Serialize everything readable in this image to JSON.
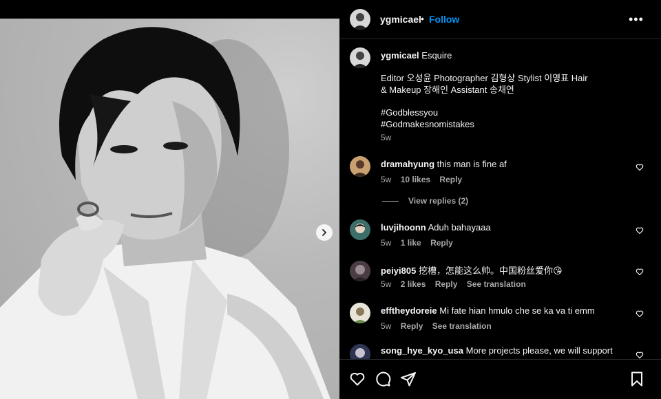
{
  "post": {
    "username": "ygmicael",
    "follow_label": "Follow",
    "more_label": "•••",
    "dot": "•"
  },
  "caption": {
    "username": "ygmicael",
    "title": "Esquire",
    "line1": "Editor 오성윤 Photographer 김형상 Stylist 이영표 Hair",
    "line2": "& Makeup 장해인 Assistant 송채연",
    "tag1": "#Godblessyou",
    "tag2": "#Godmakesnomistakes",
    "time": "5w"
  },
  "comments": [
    {
      "username": "dramahyung",
      "text": "this man is fine af",
      "time": "5w",
      "likes": "10 likes",
      "reply": "Reply",
      "translate": ""
    },
    {
      "username": "luvjihoonn",
      "text": "Aduh bahayaaa",
      "time": "5w",
      "likes": "1 like",
      "reply": "Reply",
      "translate": ""
    },
    {
      "username": "peiyi805",
      "text": "挖槽，怎能这么帅。中国粉丝爱你😘",
      "time": "5w",
      "likes": "2 likes",
      "reply": "Reply",
      "translate": "See translation"
    },
    {
      "username": "efftheydoreie",
      "text": "Mi fate hian hmulo che se ka va ti emm",
      "time": "5w",
      "likes": "",
      "reply": "Reply",
      "translate": "See translation"
    },
    {
      "username": "song_hye_kyo_usa",
      "text": "More projects please, we will support",
      "time": "",
      "likes": "",
      "reply": "",
      "translate": ""
    }
  ],
  "view_replies": "View replies (2)",
  "colors": {
    "accent": "#0095f6",
    "muted": "#a8a8a8",
    "background": "#000000"
  },
  "icons": [
    "heart-icon",
    "comment-icon",
    "share-icon",
    "bookmark-icon",
    "more-icon",
    "chevron-right-icon"
  ]
}
